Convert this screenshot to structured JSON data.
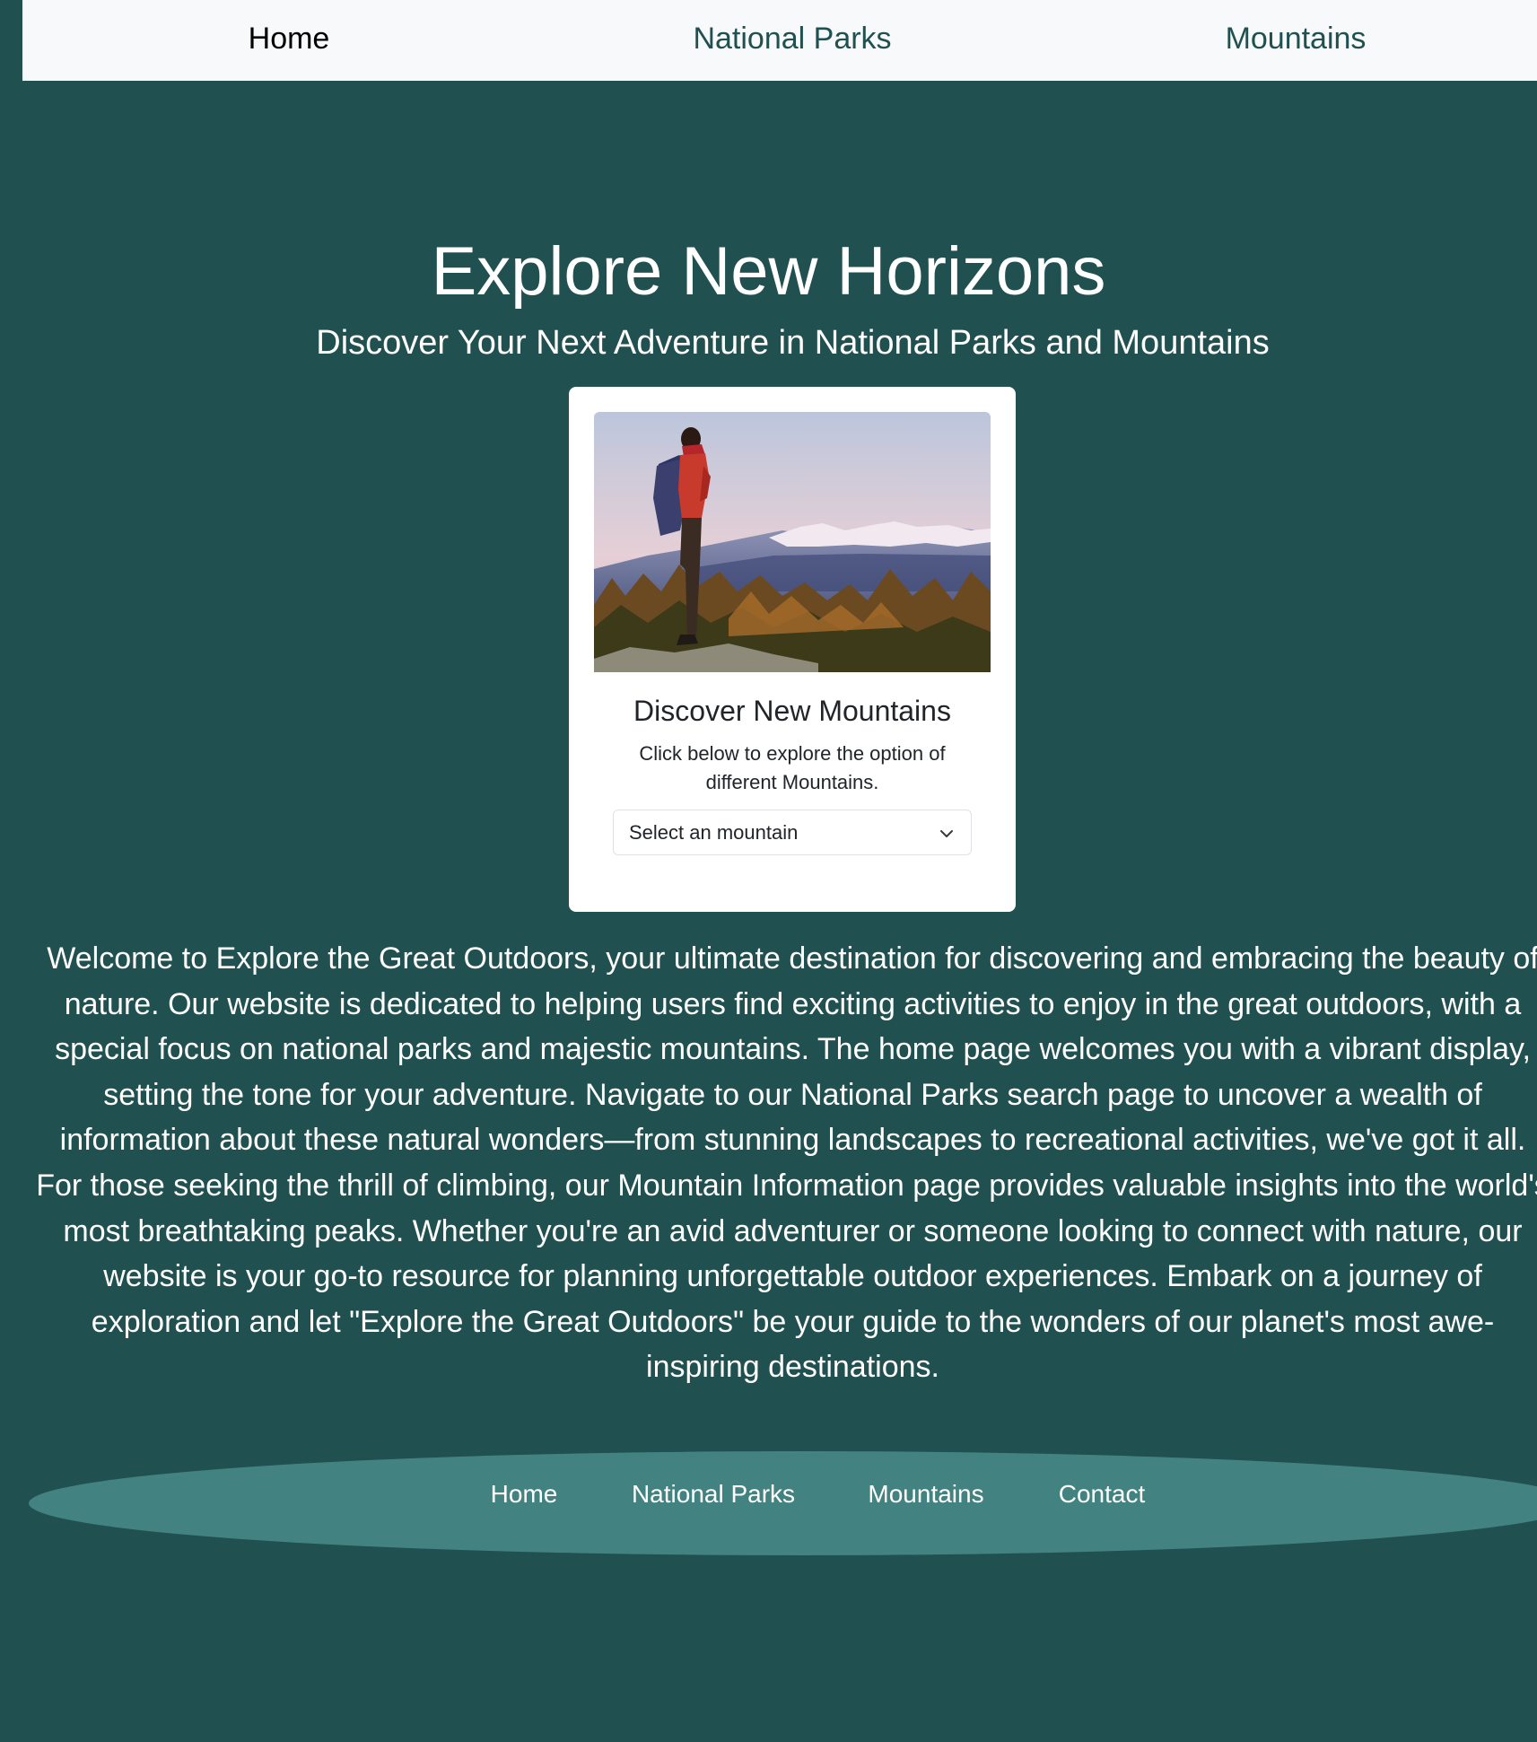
{
  "nav": {
    "items": [
      {
        "label": "Home",
        "active": true
      },
      {
        "label": "National Parks",
        "active": false
      },
      {
        "label": "Mountains",
        "active": false
      }
    ]
  },
  "hero": {
    "title": "Explore New Horizons",
    "subtitle": "Discover Your Next Adventure in National Parks and Mountains"
  },
  "card": {
    "image_alt": "hiker on mountain summit",
    "title": "Discover New Mountains",
    "text": "Click below to explore the option of different Mountains.",
    "select": {
      "value": "Select an mountain"
    }
  },
  "welcome_text": "Welcome to Explore the Great Outdoors, your ultimate destination for discovering and embracing the beauty of nature. Our website is dedicated to helping users find exciting activities to enjoy in the great outdoors, with a special focus on national parks and majestic mountains. The home page welcomes you with a vibrant display, setting the tone for your adventure. Navigate to our National Parks search page to uncover a wealth of information about these natural wonders—from stunning landscapes to recreational activities, we've got it all. For those seeking the thrill of climbing, our Mountain Information page provides valuable insights into the world's most breathtaking peaks. Whether you're an avid adventurer or someone looking to connect with nature, our website is your go-to resource for planning unforgettable outdoor experiences. Embark on a journey of exploration and let \"Explore the Great Outdoors\" be your guide to the wonders of our planet's most awe-inspiring destinations.",
  "footer": {
    "links": [
      "Home",
      "National Parks",
      "Mountains",
      "Contact"
    ]
  },
  "colors": {
    "background": "#215050",
    "nav_background": "#f8f9fa",
    "nav_link": "#215050",
    "footer_ellipse": "#428382",
    "card_background": "#ffffff"
  }
}
